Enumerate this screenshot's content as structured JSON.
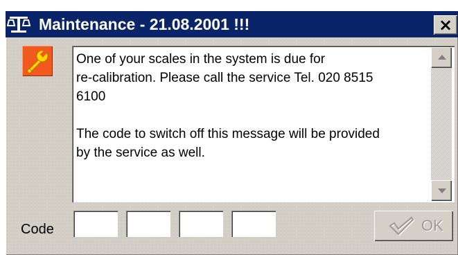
{
  "window": {
    "title": "Maintenance - 21.08.2001 !!!",
    "close_symbol": "×",
    "icon": "scale-icon"
  },
  "message": {
    "icon": "wrench-icon",
    "text": "One of your scales in the system is due for\nre-calibration. Please call the service Tel. 020 8515\n6100\n\nThe code to switch off this message will be provided\nby the service as well."
  },
  "code": {
    "label": "Code",
    "fields": [
      "",
      "",
      "",
      ""
    ]
  },
  "ok_button": {
    "label": "OK",
    "icon": "checkmark-icon",
    "disabled": true
  },
  "colors": {
    "titlebar": "#0a246a",
    "face": "#d4d0c8",
    "wrench_bg": "#f25a1d",
    "wrench": "#ffd800",
    "disabled_text": "#a09c94"
  }
}
